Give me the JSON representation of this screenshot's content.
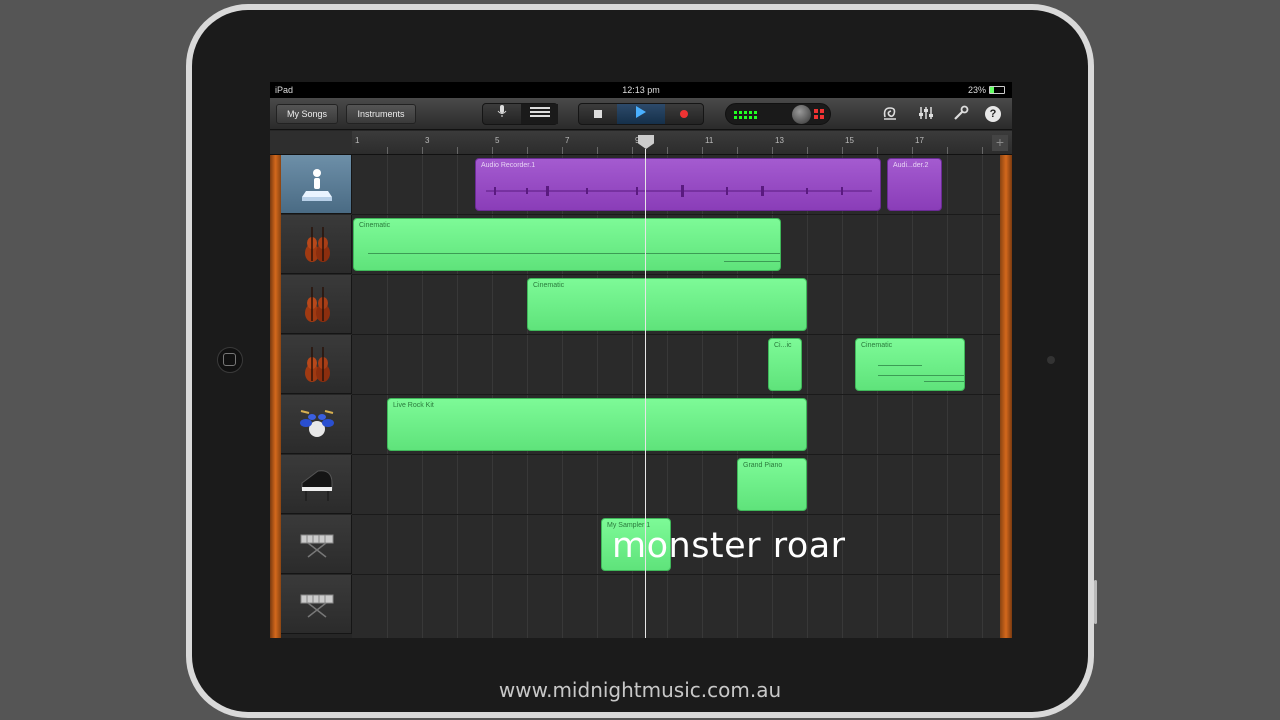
{
  "status": {
    "device": "iPad",
    "time": "12:13 pm",
    "battery": "23%"
  },
  "toolbar": {
    "my_songs_label": "My Songs",
    "instruments_label": "Instruments",
    "icons": [
      "microphone-icon",
      "tracks-view-icon",
      "stop-icon",
      "play-icon",
      "record-icon",
      "loop-browser-icon",
      "mixer-icon",
      "settings-wrench-icon",
      "help-icon"
    ],
    "play_color": "#4ab0ff",
    "record_color": "#e33333"
  },
  "ruler": {
    "bars": [
      "1",
      "3",
      "5",
      "7",
      "9",
      "11",
      "13",
      "15",
      "17"
    ],
    "add_label": "+"
  },
  "tracks": [
    {
      "instrument": "audio-recorder-icon"
    },
    {
      "instrument": "strings-icon"
    },
    {
      "instrument": "strings-icon"
    },
    {
      "instrument": "strings-icon"
    },
    {
      "instrument": "drum-kit-icon"
    },
    {
      "instrument": "grand-piano-icon"
    },
    {
      "instrument": "keyboard-icon"
    },
    {
      "instrument": "keyboard-icon"
    }
  ],
  "regions": {
    "audio1": "Audio Recorder.1",
    "audio2": "Audi...der.2",
    "cine1": "Cinematic",
    "cine2": "Cinematic",
    "cine3": "Ci...ic",
    "cine4": "Cinematic",
    "drums": "Live Rock Kit",
    "piano": "Grand Piano",
    "sampler": "My Sampler 1"
  },
  "overlay": {
    "caption": "monster roar",
    "url": "www.midnightmusic.com.au"
  },
  "colors": {
    "midi_region": "#6ff08a",
    "audio_region": "#9a4cc6",
    "wood": "#d3681c"
  }
}
